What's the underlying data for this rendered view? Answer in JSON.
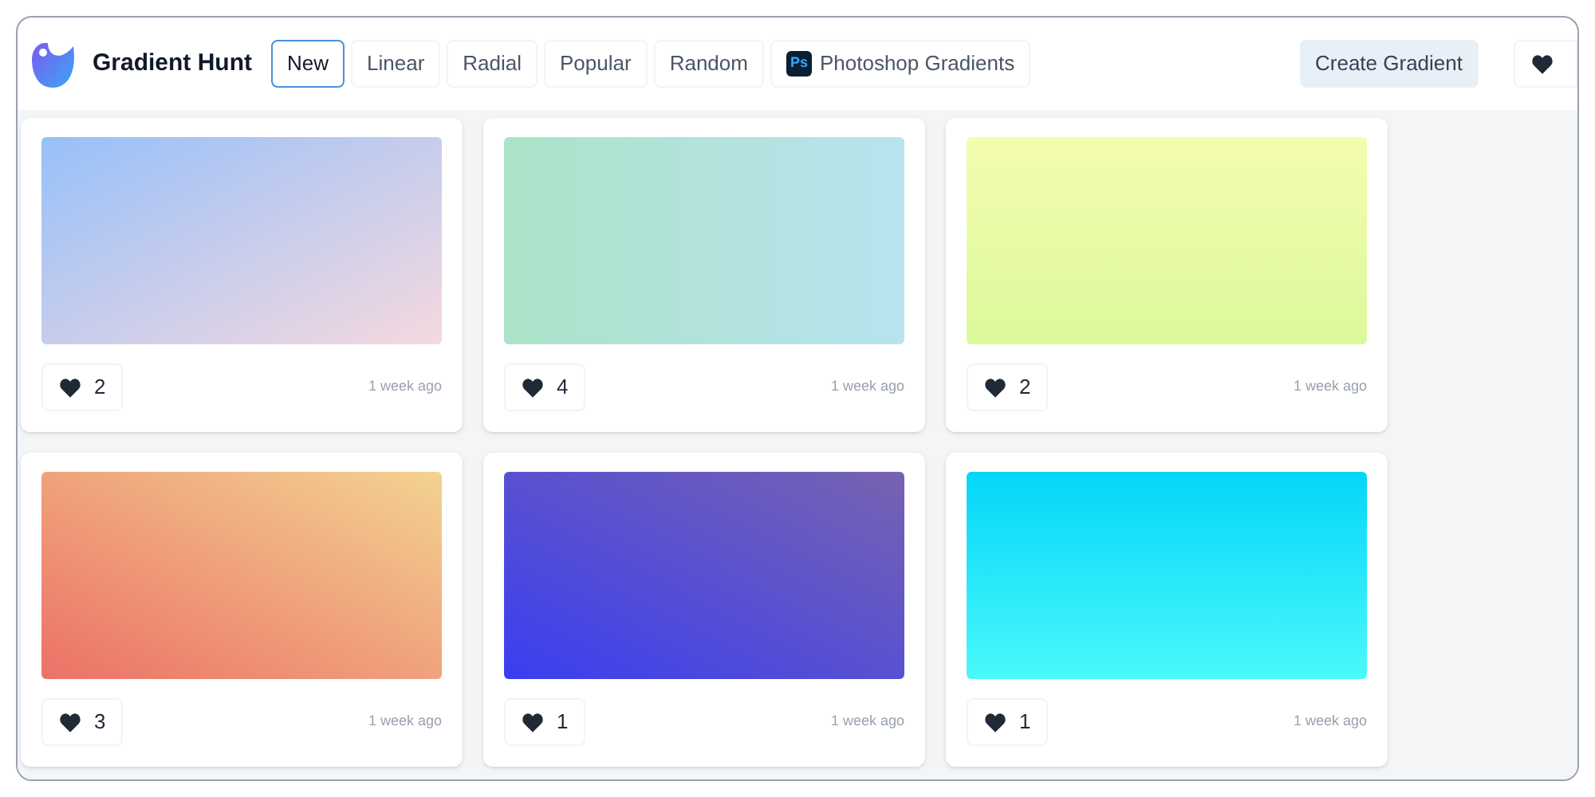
{
  "brand": {
    "name": "Gradient Hunt"
  },
  "tabs": [
    {
      "label": "New",
      "selected": true
    },
    {
      "label": "Linear",
      "selected": false
    },
    {
      "label": "Radial",
      "selected": false
    },
    {
      "label": "Popular",
      "selected": false
    },
    {
      "label": "Random",
      "selected": false
    },
    {
      "label": "Photoshop Gradients",
      "selected": false,
      "badge": "Ps"
    }
  ],
  "create_button": "Create Gradient",
  "gradients": [
    {
      "kind": "diagonal",
      "stops": [
        {
          "color": "#97c0f9"
        },
        {
          "color": "#f5d9df"
        }
      ],
      "likes": "2",
      "time": "1 week ago"
    },
    {
      "kind": "horizontal",
      "stops": [
        {
          "color": "#abe3c8"
        },
        {
          "color": "#b8e3ef"
        }
      ],
      "likes": "4",
      "time": "1 week ago"
    },
    {
      "kind": "vertical",
      "stops": [
        {
          "color": "#f4fcaf"
        },
        {
          "color": "#dcf99a"
        }
      ],
      "likes": "2",
      "time": "1 week ago"
    },
    {
      "kind": "rising",
      "stops": [
        {
          "color": "#ec7167"
        },
        {
          "color": "#f3d391"
        }
      ],
      "likes": "3",
      "time": "1 week ago"
    },
    {
      "kind": "rising",
      "stops": [
        {
          "color": "#3a3ef0"
        },
        {
          "color": "#7763b0"
        }
      ],
      "likes": "1",
      "time": "1 week ago"
    },
    {
      "kind": "vertical",
      "stops": [
        {
          "color": "#04d6f8"
        },
        {
          "color": "#4af9fb"
        }
      ],
      "likes": "1",
      "time": "1 week ago"
    }
  ]
}
